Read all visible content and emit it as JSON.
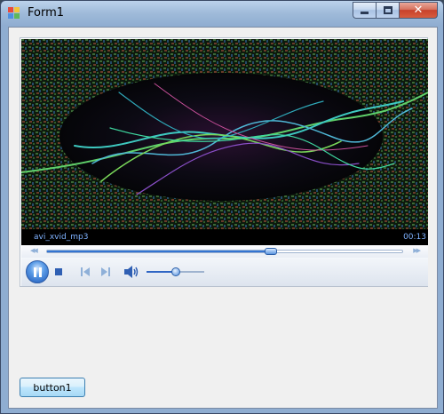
{
  "window": {
    "title": "Form1",
    "minimize_icon": "minimize-icon",
    "maximize_icon": "maximize-icon",
    "close_glyph": "✕"
  },
  "player": {
    "media_name": "avi_xvid_mp3",
    "time": "00:13",
    "seek_progress": 0.63,
    "volume_level": 0.5,
    "state": "playing",
    "icons": {
      "play_pause": "pause-icon",
      "stop": "stop-icon",
      "previous": "previous-icon",
      "next": "next-icon",
      "volume": "speaker-icon"
    },
    "colors": {
      "accent": "#1f5fc2",
      "time_text": "#7fb2ff"
    }
  },
  "button1": {
    "label": "button1"
  }
}
